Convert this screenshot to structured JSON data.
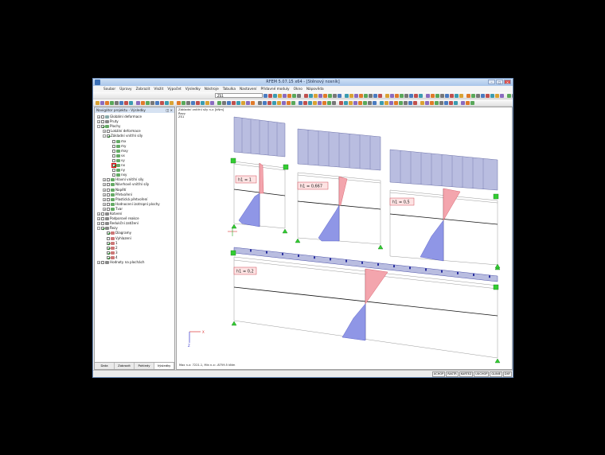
{
  "window": {
    "title": "RFEM 5.07.15 x64 - [Stěnový nosník]"
  },
  "menu": [
    "Soubor",
    "Úpravy",
    "Zobrazit",
    "Vložit",
    "Výpočet",
    "Výsledky",
    "Nástroje",
    "Tabulka",
    "Nastavení",
    "Přídavné moduly",
    "Okno",
    "Nápověda"
  ],
  "toolbar": {
    "load_case": "ZS1"
  },
  "navigator": {
    "title": "Navigátor projektu - Výsledky",
    "items": [
      {
        "label": "Globální deformace"
      },
      {
        "label": "Pruty"
      },
      {
        "label": "Plochy"
      },
      {
        "label": "Lokální deformace"
      },
      {
        "label": "Základní vnitřní síly"
      },
      {
        "label": "mx"
      },
      {
        "label": "my"
      },
      {
        "label": "mxy"
      },
      {
        "label": "vx"
      },
      {
        "label": "vy"
      },
      {
        "label": "nx"
      },
      {
        "label": "ny"
      },
      {
        "label": "nxy"
      },
      {
        "label": "Hlavní vnitřní síly"
      },
      {
        "label": "Návrhové vnitřní síly"
      },
      {
        "label": "Napětí"
      },
      {
        "label": "Přetvoření"
      },
      {
        "label": "Plastická přetvoření"
      },
      {
        "label": "Hodnocení izotropní plochy"
      },
      {
        "label": "Tvar"
      },
      {
        "label": "Kotvení"
      },
      {
        "label": "Podporové reakce"
      },
      {
        "label": "Redukční zatížení"
      },
      {
        "label": "Řezy"
      },
      {
        "label": "Diagramy"
      },
      {
        "label": "Vyhlazení"
      },
      {
        "label": "1"
      },
      {
        "label": "2"
      },
      {
        "label": "3"
      },
      {
        "label": "4"
      },
      {
        "label": "Hodnoty na plochách"
      }
    ],
    "tabs": [
      "Data",
      "Zobrazit",
      "Pohledy",
      "Výsledky"
    ]
  },
  "viewport": {
    "info_lines": [
      "Základní vnitřní síly n-x [kNm]",
      "Řezy",
      "ZS1"
    ],
    "footer": "Max n-x: 7221.1, Min n-x: -8759.5 kNm",
    "labels": {
      "p1": "h1 = 1",
      "p2": "h1 = 0,667",
      "p3": "h1 = 0,5",
      "p4": "h1 = 0,2"
    }
  },
  "status": [
    "UCHOP",
    "RASTR",
    "KARTEZ",
    "UUCHOP",
    "GLINIE",
    "DXF"
  ],
  "colors": {
    "load_fill": "#b9bde0",
    "tension": "#f3a5ad",
    "compression": "#8f96e6",
    "support": "#33cc33",
    "label_bg": "#fde3e3"
  }
}
